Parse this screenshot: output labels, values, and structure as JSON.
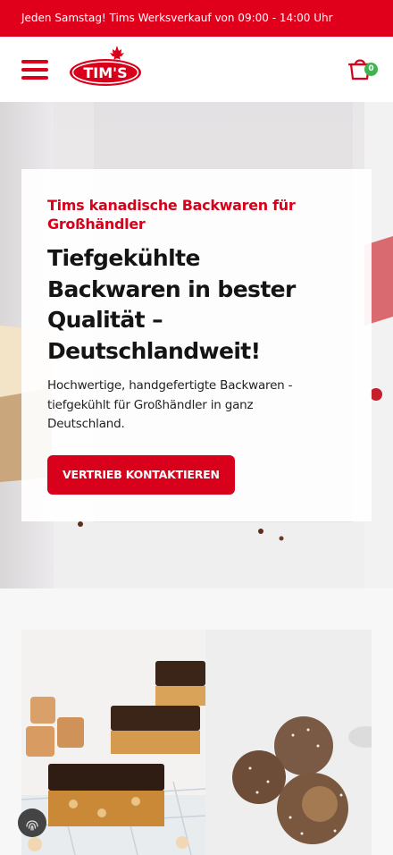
{
  "announcement": "Jeden Samstag! Tims Werksverkauf von 09:00 - 14:00 Uhr",
  "header": {
    "menu_icon": "hamburger-menu-icon",
    "logo_text": "TIM'S",
    "cart_icon": "shopping-basket-icon",
    "cart_count": "0"
  },
  "hero": {
    "eyebrow_line1": "Tims kanadische Backwaren für",
    "eyebrow_line2": "Großhändler",
    "headline_line1": "Tiefgekühlte",
    "headline_line2": "Backwaren in bester",
    "headline_line3": "Qualität –",
    "headline_line4": "Deutschlandweit!",
    "subtext_line1": "Hochwertige, handgefertigte Backwaren -",
    "subtext_line2": "tiefgekühlt für Großhändler in ganz",
    "subtext_line3": "Deutschland.",
    "cta_label": "VERTRIEB KONTAKTIEREN"
  },
  "products": [
    {
      "image": "caramel-chocolate-bars-photo"
    },
    {
      "image": "coconut-energy-balls-photo"
    }
  ],
  "colors": {
    "brand_red": "#d8001a",
    "topbar_red": "#e0001b",
    "badge_green": "#3fb34f"
  }
}
